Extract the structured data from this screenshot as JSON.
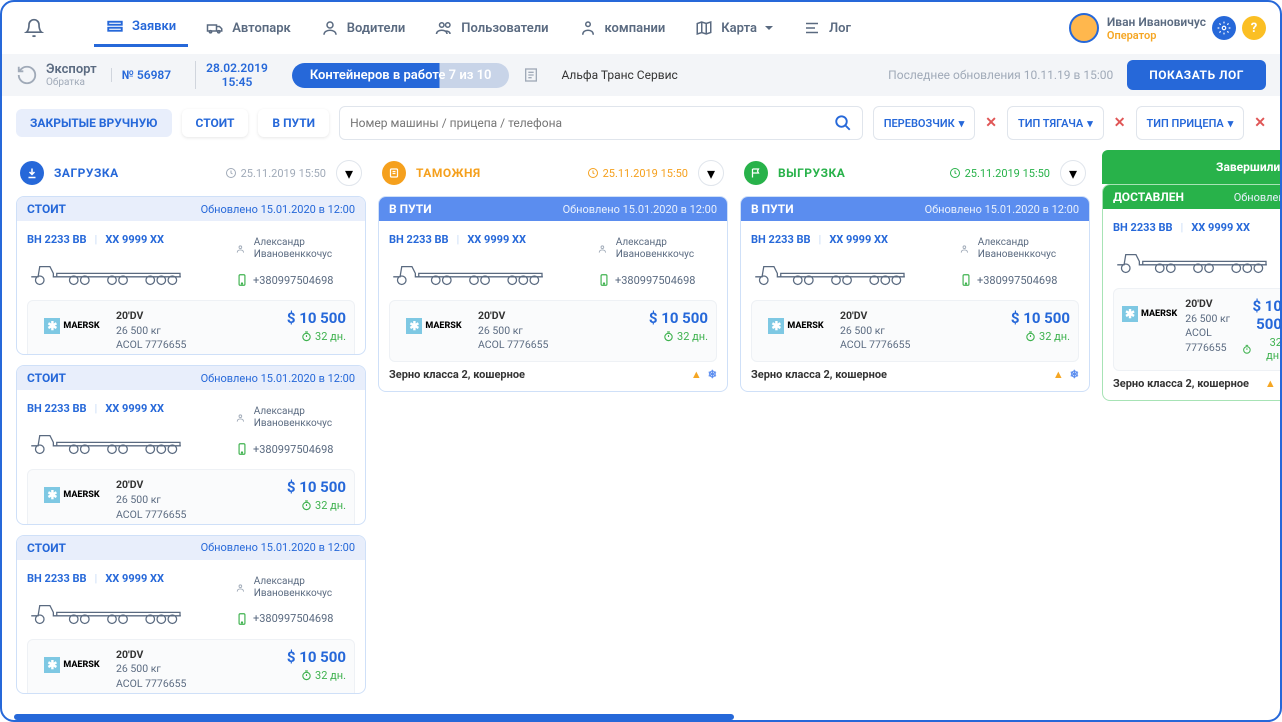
{
  "nav": {
    "items": [
      {
        "label": "Заявки"
      },
      {
        "label": "Автопарк"
      },
      {
        "label": "Водители"
      },
      {
        "label": "Пользователи"
      },
      {
        "label": "компании"
      },
      {
        "label": "Карта"
      },
      {
        "label": "Лог"
      }
    ],
    "user": {
      "name": "Иван Ивановичус",
      "role": "Оператор"
    }
  },
  "infobar": {
    "title": "Экспорт",
    "subtitle": "Обратка",
    "order_no": "№ 56987",
    "date": "28.02.2019",
    "time": "15:45",
    "progress": "Контейнеров в работе 7 из 10",
    "company": "Альфа Транс Сервис",
    "updated": "Последнее обновления 10.11.19 в 15:00",
    "button": "ПОКАЗАТЬ ЛОГ"
  },
  "filters": {
    "tabs": [
      "ЗАКРЫТЫЕ ВРУЧНУЮ",
      "СТОИТ",
      "В ПУТИ"
    ],
    "search_placeholder": "Номер машины / прицепа / телефона",
    "dd1": "ПЕРЕВОЗЧИК",
    "dd2": "ТИП ТЯГАЧА",
    "dd3": "ТИП ПРИЦЕПА"
  },
  "columns": [
    {
      "title": "ЗАГРУЗКА",
      "ts": "25.11.2019 15:50",
      "color": "#2668d9"
    },
    {
      "title": "ТАМОЖНЯ",
      "ts": "25.11.2019 15:50",
      "color": "#f5a01d"
    },
    {
      "title": "ВЫГРУЗКА",
      "ts": "25.11.2019 15:50",
      "color": "#28b24a"
    },
    {
      "title": "Завершили п",
      "ts": ""
    }
  ],
  "card": {
    "status_stoit": "СТОИТ",
    "status_drive": "В ПУТИ",
    "status_done": "ДОСТАВЛЕН",
    "updated": "Обновлено 15.01.2020 в 12:00",
    "updated_short": "Обновлено",
    "plate1": "ВН 2233 ВВ",
    "plate2": "ХХ 9999 ХХ",
    "driver": "Александр Ивановенккочус",
    "phone": "+380997504698",
    "size": "20'DV",
    "weight": "26 500 кг",
    "acol": "ACOL 7776655",
    "price": "$ 10 500",
    "days": "32 дн.",
    "cargo": "Зерно класса 2, кошерное",
    "brand": "MAERSK"
  }
}
